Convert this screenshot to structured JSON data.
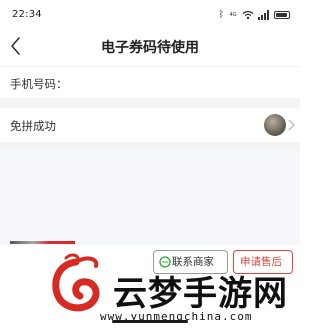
{
  "status_bar": {
    "time": "22:34",
    "net_badge": "4G"
  },
  "nav": {
    "title": "电子券码待使用"
  },
  "phone": {
    "label": "手机号码："
  },
  "group": {
    "status": "免拼成功"
  },
  "actions": {
    "contact_label": "联系商家",
    "aftersale_label": "申请售后"
  },
  "watermark": {
    "brand": "云梦手游网",
    "url": "www.yunmengchina.com"
  },
  "colors": {
    "accent": "#e0483e",
    "chat_icon": "#27a43a",
    "page_gap": "#f4f4f4"
  },
  "icons": [
    "back-arrow-icon",
    "bluetooth-icon",
    "wifi-icon",
    "signal-icon",
    "battery-icon",
    "chevron-right-icon",
    "chat-icon"
  ]
}
